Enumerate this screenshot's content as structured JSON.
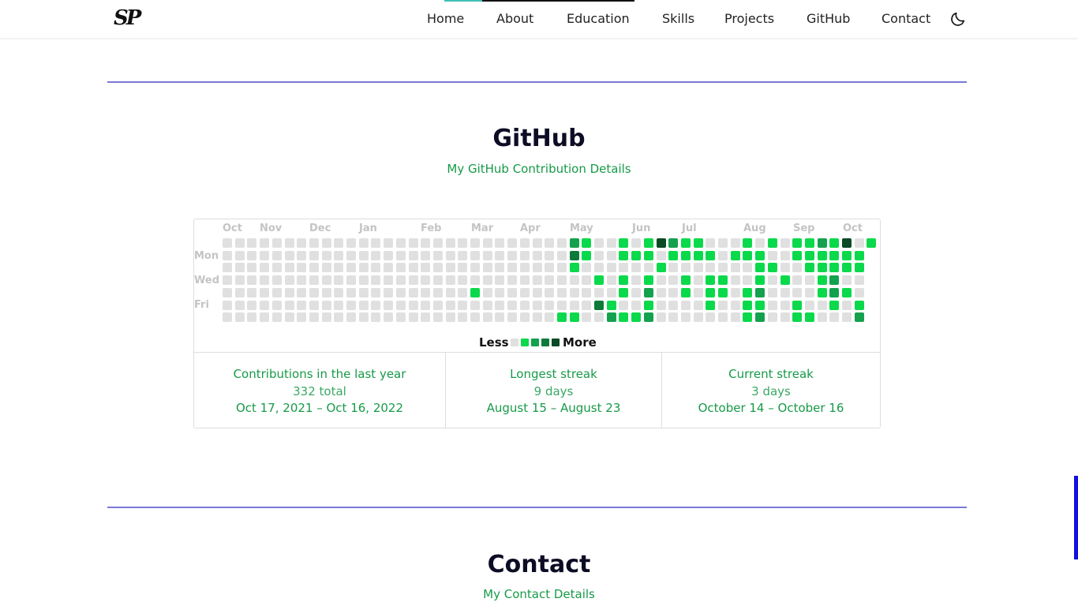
{
  "header": {
    "logo_text": "SP",
    "nav": [
      "Home",
      "About",
      "Education",
      "Skills",
      "Projects",
      "GitHub",
      "Contact"
    ],
    "theme_toggle_icon": "moon-icon"
  },
  "github_section": {
    "title": "GitHub",
    "subtitle": "My GitHub Contribution Details"
  },
  "calendar": {
    "months": [
      "Oct",
      "Nov",
      "Dec",
      "Jan",
      "Feb",
      "Mar",
      "Apr",
      "May",
      "Jun",
      "Jul",
      "Aug",
      "Sep",
      "Oct"
    ],
    "day_labels": [
      "Mon",
      "Wed",
      "Fri"
    ],
    "level_colors": [
      "#e0e0e0",
      "#0ad94b",
      "#14a14e",
      "#0e7a3a",
      "#0a4a24"
    ],
    "weeks": [
      [
        0,
        0,
        0,
        0,
        0,
        0,
        0
      ],
      [
        0,
        0,
        0,
        0,
        0,
        0,
        0
      ],
      [
        0,
        0,
        0,
        0,
        0,
        0,
        0
      ],
      [
        0,
        0,
        0,
        0,
        0,
        0,
        0
      ],
      [
        0,
        0,
        0,
        0,
        0,
        0,
        0
      ],
      [
        0,
        0,
        0,
        0,
        0,
        0,
        0
      ],
      [
        0,
        0,
        0,
        0,
        0,
        0,
        0
      ],
      [
        0,
        0,
        0,
        0,
        0,
        0,
        0
      ],
      [
        0,
        0,
        0,
        0,
        0,
        0,
        0
      ],
      [
        0,
        0,
        0,
        0,
        0,
        0,
        0
      ],
      [
        0,
        0,
        0,
        0,
        0,
        0,
        0
      ],
      [
        0,
        0,
        0,
        0,
        0,
        0,
        0
      ],
      [
        0,
        0,
        0,
        0,
        0,
        0,
        0
      ],
      [
        0,
        0,
        0,
        0,
        0,
        0,
        0
      ],
      [
        0,
        0,
        0,
        0,
        0,
        0,
        0
      ],
      [
        0,
        0,
        0,
        0,
        0,
        0,
        0
      ],
      [
        0,
        0,
        0,
        0,
        0,
        0,
        0
      ],
      [
        0,
        0,
        0,
        0,
        0,
        0,
        0
      ],
      [
        0,
        0,
        0,
        0,
        0,
        0,
        0
      ],
      [
        0,
        0,
        0,
        0,
        0,
        0,
        0
      ],
      [
        0,
        0,
        0,
        0,
        1,
        0,
        0
      ],
      [
        0,
        0,
        0,
        0,
        0,
        0,
        0
      ],
      [
        0,
        0,
        0,
        0,
        0,
        0,
        0
      ],
      [
        0,
        0,
        0,
        0,
        0,
        0,
        0
      ],
      [
        0,
        0,
        0,
        0,
        0,
        0,
        0
      ],
      [
        0,
        0,
        0,
        0,
        0,
        0,
        0
      ],
      [
        0,
        0,
        0,
        0,
        0,
        0,
        0
      ],
      [
        0,
        0,
        0,
        0,
        0,
        0,
        1
      ],
      [
        2,
        3,
        1,
        0,
        0,
        0,
        1
      ],
      [
        1,
        1,
        0,
        0,
        0,
        0,
        0
      ],
      [
        0,
        0,
        0,
        1,
        0,
        3,
        0
      ],
      [
        0,
        0,
        0,
        0,
        0,
        1,
        2
      ],
      [
        1,
        1,
        0,
        1,
        1,
        0,
        1
      ],
      [
        0,
        1,
        0,
        0,
        0,
        0,
        1
      ],
      [
        1,
        1,
        0,
        1,
        2,
        1,
        2
      ],
      [
        4,
        0,
        1,
        0,
        0,
        0,
        0
      ],
      [
        2,
        1,
        0,
        0,
        0,
        0,
        0
      ],
      [
        1,
        1,
        0,
        1,
        1,
        0,
        0
      ],
      [
        1,
        1,
        0,
        0,
        0,
        0,
        0
      ],
      [
        0,
        1,
        0,
        1,
        1,
        1,
        0
      ],
      [
        0,
        0,
        0,
        1,
        1,
        0,
        0
      ],
      [
        0,
        1,
        0,
        0,
        0,
        0,
        0
      ],
      [
        1,
        1,
        0,
        0,
        1,
        1,
        1
      ],
      [
        0,
        1,
        1,
        1,
        2,
        1,
        2
      ],
      [
        1,
        0,
        1,
        0,
        0,
        0,
        0
      ],
      [
        0,
        0,
        0,
        1,
        0,
        0,
        0
      ],
      [
        1,
        1,
        0,
        0,
        0,
        1,
        1
      ],
      [
        1,
        1,
        1,
        0,
        0,
        0,
        1
      ],
      [
        2,
        1,
        1,
        1,
        1,
        0,
        0
      ],
      [
        1,
        1,
        1,
        2,
        2,
        1,
        0
      ],
      [
        4,
        1,
        1,
        0,
        1,
        0,
        0
      ],
      [
        0,
        1,
        1,
        0,
        0,
        1,
        2
      ],
      [
        1
      ]
    ],
    "legend_less": "Less",
    "legend_more": "More"
  },
  "stats": [
    {
      "title": "Contributions in the last year",
      "value": "332 total",
      "range": "Oct 17, 2021 – Oct 16, 2022"
    },
    {
      "title": "Longest streak",
      "value": "9 days",
      "range": "August 15 – August 23"
    },
    {
      "title": "Current streak",
      "value": "3 days",
      "range": "October 14 – October 16"
    }
  ],
  "contact_section": {
    "title": "Contact",
    "subtitle": "My Contact Details"
  }
}
